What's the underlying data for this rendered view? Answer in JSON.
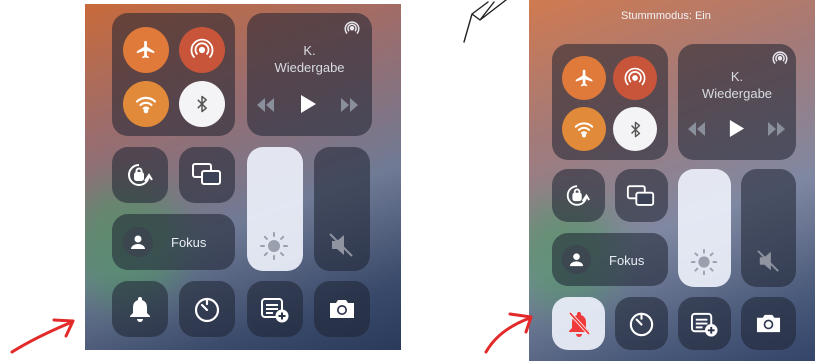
{
  "left": {
    "media": {
      "line1": "K.",
      "line2": "Wiedergabe"
    },
    "focus_label": "Fokus"
  },
  "right": {
    "status_text": "Stummmodus: Ein",
    "media": {
      "line1": "K.",
      "line2": "Wiedergabe"
    },
    "focus_label": "Fokus"
  },
  "levels": {
    "left_brightness": 0.75,
    "right_brightness": 0.65,
    "left_volume": 0.0,
    "right_volume": 0.0
  },
  "icons": [
    "airplane-icon",
    "airdrop-icon",
    "wifi-icon",
    "bluetooth-icon",
    "airplay-icon",
    "rewind-icon",
    "play-icon",
    "forward-icon",
    "rotation-lock-icon",
    "screen-mirroring-icon",
    "person-icon",
    "brightness-icon",
    "mute-speaker-icon",
    "bell-icon",
    "bell-slash-icon",
    "timer-icon",
    "notes-add-icon",
    "camera-icon"
  ],
  "colors": {
    "accent_orange": "#e07a3a",
    "annotation_red": "#e32a2a",
    "silent_active": "#f03a3a"
  }
}
